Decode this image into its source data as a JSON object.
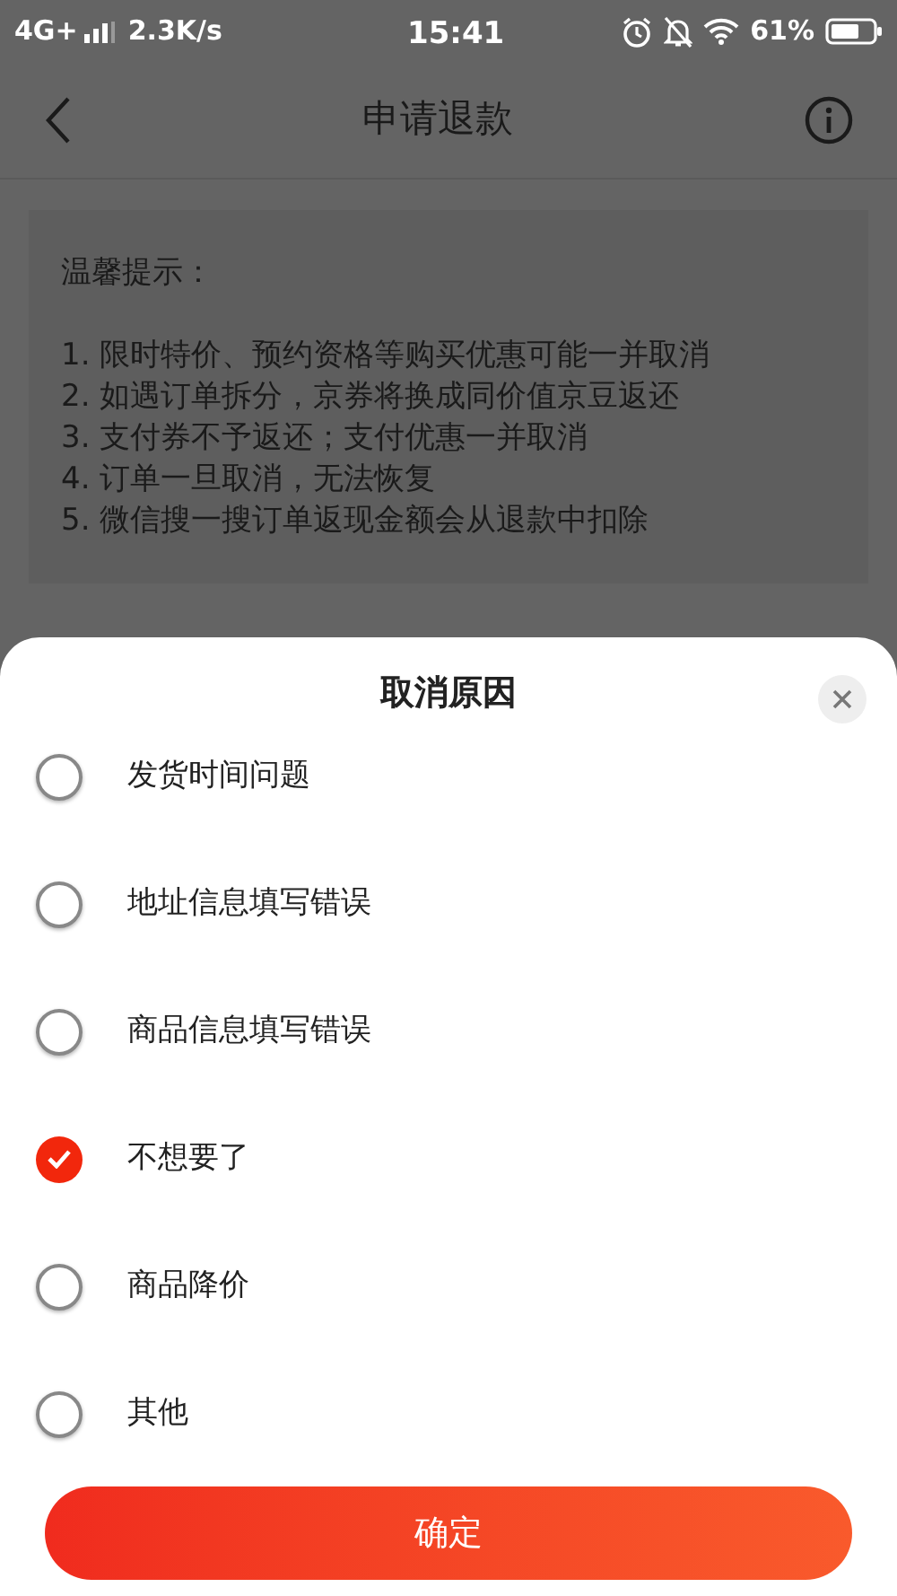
{
  "status_bar": {
    "network": "4G+",
    "speed": "2.3K/s",
    "time": "15:41",
    "battery": "61%"
  },
  "header": {
    "title": "申请退款"
  },
  "notice": {
    "title": "温馨提示：",
    "items": [
      "1. 限时特价、预约资格等购买优惠可能一并取消",
      "2. 如遇订单拆分，京券将换成同价值京豆返还",
      "3. 支付券不予返还；支付优惠一并取消",
      "4. 订单一旦取消，无法恢复",
      "5. 微信搜一搜订单返现金额会从退款中扣除"
    ]
  },
  "sheet": {
    "title": "取消原因",
    "options": [
      {
        "label": "发货时间问题",
        "selected": false
      },
      {
        "label": "地址信息填写错误",
        "selected": false
      },
      {
        "label": "商品信息填写错误",
        "selected": false
      },
      {
        "label": "不想要了",
        "selected": true
      },
      {
        "label": "商品降价",
        "selected": false
      },
      {
        "label": "其他",
        "selected": false
      }
    ],
    "confirm": "确定"
  }
}
